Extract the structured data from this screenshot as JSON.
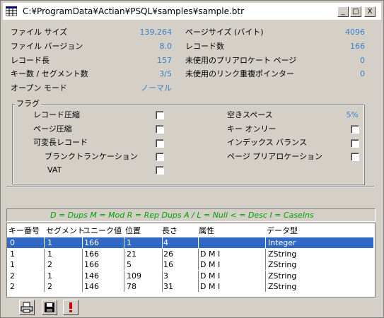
{
  "window": {
    "title": "C:¥ProgramData¥Actian¥PSQL¥samples¥sample.btr"
  },
  "titlebar_buttons": [
    "_",
    "□",
    "X"
  ],
  "info_left": [
    {
      "label": "ファイル サイズ",
      "value": "139,264"
    },
    {
      "label": "ファイル バージョン",
      "value": "8.0"
    },
    {
      "label": "レコード長",
      "value": "157"
    },
    {
      "label": "キー数 / セグメント数",
      "value": "3/5"
    },
    {
      "label": "オープン モード",
      "value": "ノーマル"
    }
  ],
  "info_right": [
    {
      "label": "ページサイズ (バイト)",
      "value": "4096"
    },
    {
      "label": "レコード数",
      "value": "166"
    },
    {
      "label": "未使用のプリアロケート ページ",
      "value": "0"
    },
    {
      "label": "未使用のリンク重複ポインター",
      "value": "0"
    }
  ],
  "flags": {
    "title": "フラグ",
    "left": [
      "レコード圧縮",
      "ページ圧縮",
      "可変長レコード",
      "ブランクトランケーション",
      "VAT"
    ],
    "right_label0": "空きスペース",
    "right_value0": "5%",
    "right": [
      "キー オンリー",
      "インデックス バランス",
      "ページ プリアロケーション"
    ]
  },
  "legend": "D = Dups   M = Mod   R = Rep  Dups   A / L = Null   < = Desc   I = CaseIns",
  "table": {
    "headers": [
      "キー番号",
      "セグメント",
      "ユニーク値",
      "位置",
      "長さ",
      "属性",
      "データ型"
    ],
    "rows": [
      [
        "0",
        "1",
        "166",
        "1",
        "4",
        "",
        "Integer"
      ],
      [
        "1",
        "1",
        "166",
        "21",
        "26",
        "D  M        I",
        "ZString"
      ],
      [
        "1",
        "2",
        "166",
        "5",
        "16",
        "D  M        I",
        "ZString"
      ],
      [
        "2",
        "1",
        "146",
        "109",
        "3",
        "D  M        I",
        "ZString"
      ],
      [
        "2",
        "2",
        "146",
        "78",
        "31",
        "D  M        I",
        "ZString"
      ]
    ]
  },
  "toolbar": [
    "print-icon",
    "save-icon",
    "exclamation-icon"
  ],
  "colors": {
    "value": "#3a7ec8",
    "legend": "#00a000",
    "selection": "#3169c6"
  }
}
